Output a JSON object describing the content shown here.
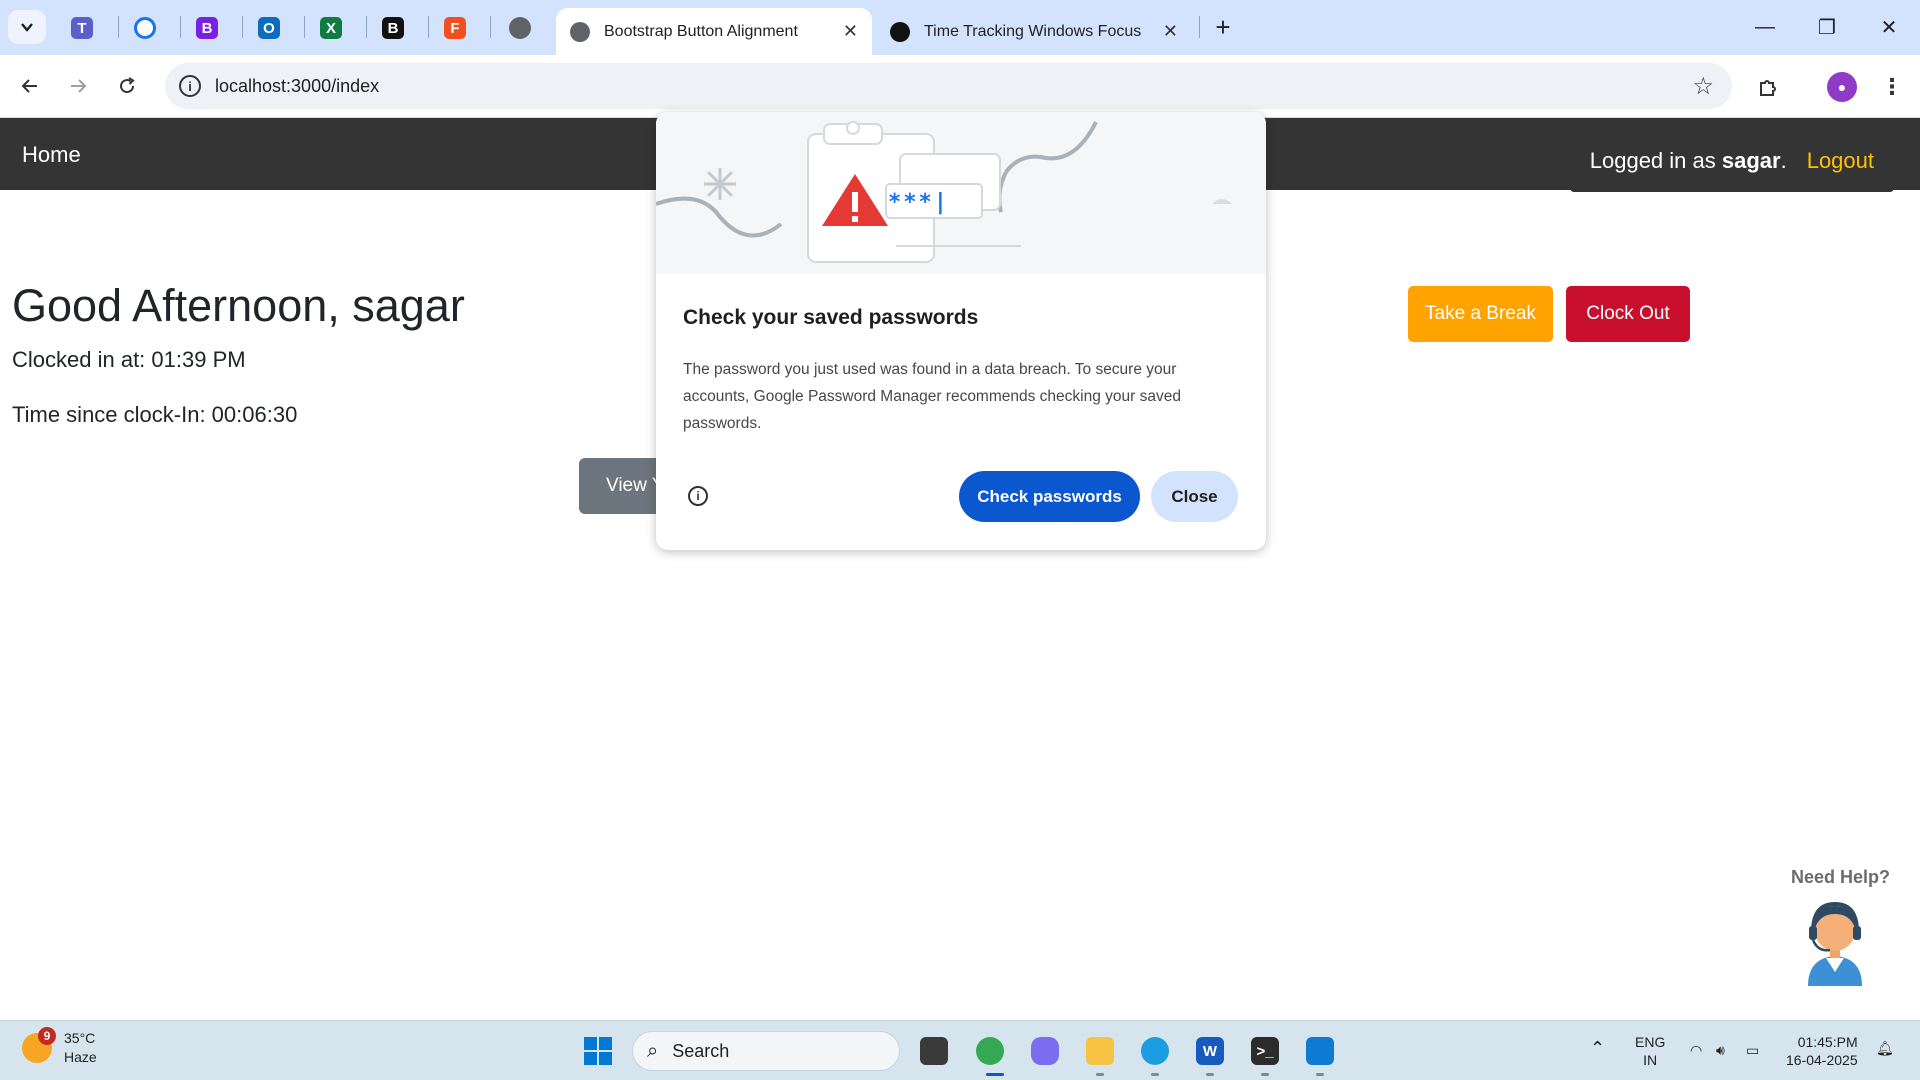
{
  "browser": {
    "tabs": [
      {
        "title": "Bootstrap Button Alignment",
        "active": true
      },
      {
        "title": "Time Tracking Windows Focus",
        "active": false
      }
    ],
    "new_tab_label": "+",
    "url": "localhost:3000/index",
    "pinned_icons": [
      "teams-icon",
      "clock-app-icon",
      "bootstrap-icon",
      "outlook-icon",
      "excel-icon",
      "bold-b-icon",
      "figma-icon",
      "globe-icon"
    ]
  },
  "app": {
    "nav": {
      "brand": "Home",
      "logged_in_prefix": "Logged in as ",
      "username": "sagar",
      "logged_in_suffix": ".",
      "logout": "Logout"
    },
    "greeting": "Good Afternoon, sagar",
    "clocked_in": "Clocked in at: 01:39 PM",
    "time_since": "Time since clock-In: 00:06:30",
    "view_button": "View Y",
    "break_button": "Take a Break",
    "clock_out_button": "Clock Out",
    "help_label": "Need Help?"
  },
  "password_bubble": {
    "title": "Check your saved passwords",
    "body": "The password you just used was found in a data breach. To secure your accounts, Google Password Manager recommends checking your saved passwords.",
    "hero_mask": "***|",
    "check_button": "Check passwords",
    "close_button": "Close"
  },
  "taskbar": {
    "weather_alert_count": "9",
    "temperature": "35°C",
    "condition": "Haze",
    "search_placeholder": "Search",
    "language": "ENG",
    "region": "IN",
    "time": "01:45:PM",
    "date": "16-04-2025"
  },
  "colors": {
    "accent_blue": "#0b57d0",
    "break_orange": "#ffa300",
    "clockout_red": "#c8102e",
    "logout_yellow": "#ffc107",
    "navbar_dark": "#343434"
  }
}
